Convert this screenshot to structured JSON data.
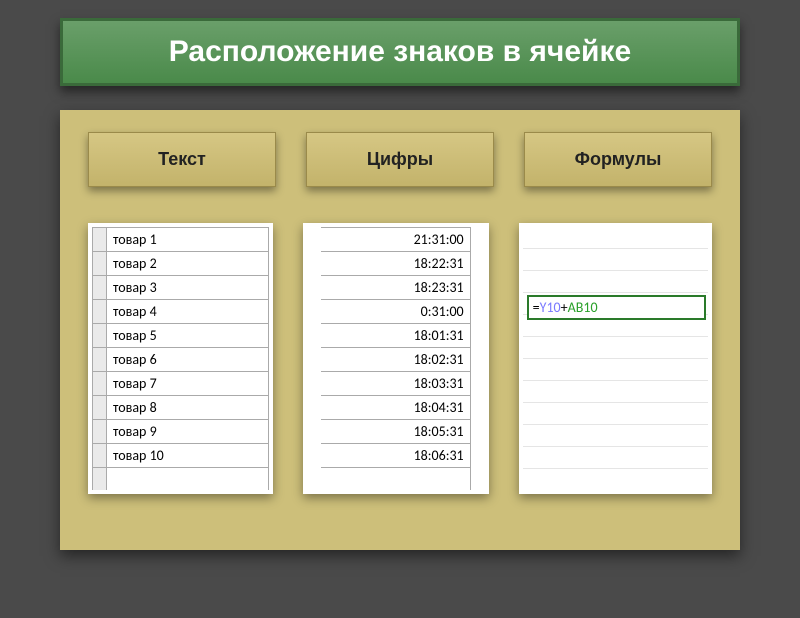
{
  "title": "Расположение знаков в ячейке",
  "headers": {
    "text": "Текст",
    "numbers": "Цифры",
    "formulas": "Формулы"
  },
  "text_column": [
    "товар 1",
    "товар 2",
    "товар 3",
    "товар 4",
    "товар 5",
    "товар 6",
    "товар 7",
    "товар 8",
    "товар 9",
    "товар 10"
  ],
  "numbers_column": [
    "21:31:00",
    "18:22:31",
    "18:23:31",
    "0:31:00",
    "18:01:31",
    "18:02:31",
    "18:03:31",
    "18:04:31",
    "18:05:31",
    "18:06:31"
  ],
  "formula": {
    "eq": "=",
    "ref1": "Y10",
    "plus": "+",
    "ref2": "AB10"
  }
}
